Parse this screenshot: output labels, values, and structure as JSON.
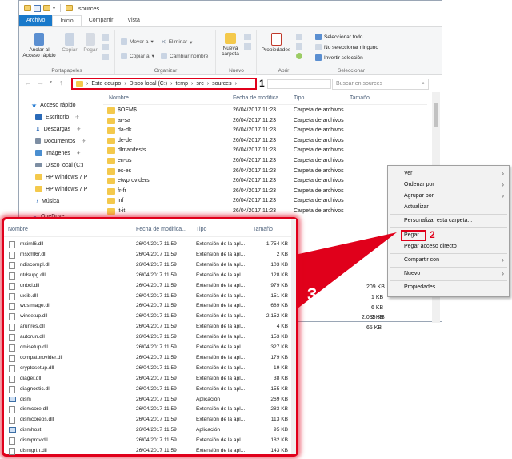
{
  "window": {
    "title": "sources"
  },
  "ribbon_tabs": [
    "Archivo",
    "Inicio",
    "Compartir",
    "Vista"
  ],
  "ribbon": {
    "portapapeles": {
      "label": "Portapapeles",
      "anclar": "Anclar al",
      "anclar2": "Acceso rápido",
      "copiar": "Copiar",
      "pegar": "Pegar"
    },
    "organizar": {
      "label": "Organizar",
      "mover": "Mover a",
      "copiar_a": "Copiar a",
      "eliminar": "Eliminar",
      "cambiar": "Cambiar nombre"
    },
    "nuevo": {
      "label": "Nuevo",
      "nueva": "Nueva",
      "carpeta": "carpeta"
    },
    "abrir": {
      "label": "Abrir",
      "propiedades": "Propiedades"
    },
    "seleccionar": {
      "label": "Seleccionar",
      "todo": "Seleccionar todo",
      "ninguno": "No seleccionar ninguno",
      "invertir": "Invertir selección"
    }
  },
  "address": {
    "path": [
      "Este equipo",
      "Disco local (C:)",
      "temp",
      "src",
      "sources"
    ],
    "marker": "1"
  },
  "search": {
    "placeholder": "Buscar en sources"
  },
  "nav_pane": [
    {
      "label": "Acceso rápido",
      "icon": "star-icon",
      "color": "#1f77d0"
    },
    {
      "label": "Escritorio",
      "icon": "desktop-icon",
      "color": "#2a6ab8"
    },
    {
      "label": "Descargas",
      "icon": "download-icon",
      "color": "#2a6ab8"
    },
    {
      "label": "Documentos",
      "icon": "document-icon",
      "color": "#7d8ea3"
    },
    {
      "label": "Imágenes",
      "icon": "pictures-icon",
      "color": "#4a8ed0"
    },
    {
      "label": "Disco local (C:)",
      "icon": "drive-icon",
      "color": "#7d8ea3"
    },
    {
      "label": "HP Windows 7 P",
      "icon": "folder-icon",
      "color": "#f4c94c"
    },
    {
      "label": "HP Windows 7 P",
      "icon": "folder-icon",
      "color": "#f4c94c"
    },
    {
      "label": "Música",
      "icon": "music-icon",
      "color": "#2a6ab8"
    },
    {
      "label": "OneDrive",
      "icon": "cloud-icon",
      "color": "#1f77d0"
    }
  ],
  "list_header": {
    "nombre": "Nombre",
    "fecha": "Fecha de modifica...",
    "tipo": "Tipo",
    "tamano": "Tamaño"
  },
  "folders": [
    {
      "name": "$OEM$",
      "date": "26/04/2017 11:23",
      "type": "Carpeta de archivos"
    },
    {
      "name": "ar-sa",
      "date": "26/04/2017 11:23",
      "type": "Carpeta de archivos"
    },
    {
      "name": "da-dk",
      "date": "26/04/2017 11:23",
      "type": "Carpeta de archivos"
    },
    {
      "name": "de-de",
      "date": "26/04/2017 11:23",
      "type": "Carpeta de archivos"
    },
    {
      "name": "dlmanifests",
      "date": "26/04/2017 11:23",
      "type": "Carpeta de archivos"
    },
    {
      "name": "en-us",
      "date": "26/04/2017 11:23",
      "type": "Carpeta de archivos"
    },
    {
      "name": "es-es",
      "date": "26/04/2017 11:23",
      "type": "Carpeta de archivos"
    },
    {
      "name": "etwproviders",
      "date": "26/04/2017 11:23",
      "type": "Carpeta de archivos"
    },
    {
      "name": "fr-fr",
      "date": "26/04/2017 11:23",
      "type": "Carpeta de archivos"
    },
    {
      "name": "inf",
      "date": "26/04/2017 11:23",
      "type": "Carpeta de archivos"
    },
    {
      "name": "it-it",
      "date": "26/04/2017 11:23",
      "type": "Carpeta de archivos"
    }
  ],
  "partial_sizes": [
    "209 KB",
    "1 KB",
    "6 KB",
    "2 KB",
    "2.085 KB",
    "65 KB"
  ],
  "context_menu": {
    "ver": "Ver",
    "ordenar": "Ordenar por",
    "agrupar": "Agrupar por",
    "actualizar": "Actualizar",
    "personalizar": "Personalizar esta carpeta...",
    "pegar": "Pegar",
    "pegar_acceso": "Pegar acceso directo",
    "compartir": "Compartir con",
    "nuevo": "Nuevo",
    "propiedades": "Propiedades",
    "marker": "2"
  },
  "panel": {
    "marker": "3",
    "header": {
      "nombre": "Nombre",
      "fecha": "Fecha de modifica...",
      "tipo": "Tipo",
      "tamano": "Tamaño"
    },
    "files": [
      {
        "name": "mximl6.dll",
        "date": "26/04/2017 11:59",
        "type": "Extensión de la apl...",
        "size": "1.754 KB",
        "kind": "dll"
      },
      {
        "name": "msxml6r.dll",
        "date": "26/04/2017 11:59",
        "type": "Extensión de la apl...",
        "size": "2 KB",
        "kind": "dll"
      },
      {
        "name": "ndiscompl.dll",
        "date": "26/04/2017 11:59",
        "type": "Extensión de la apl...",
        "size": "103 KB",
        "kind": "dll"
      },
      {
        "name": "ntdsupg.dll",
        "date": "26/04/2017 11:59",
        "type": "Extensión de la apl...",
        "size": "128 KB",
        "kind": "dll"
      },
      {
        "name": "unbcl.dll",
        "date": "26/04/2017 11:59",
        "type": "Extensión de la apl...",
        "size": "979 KB",
        "kind": "dll"
      },
      {
        "name": "uxlib.dll",
        "date": "26/04/2017 11:59",
        "type": "Extensión de la apl...",
        "size": "151 KB",
        "kind": "dll"
      },
      {
        "name": "wdsimage.dll",
        "date": "26/04/2017 11:59",
        "type": "Extensión de la apl...",
        "size": "689 KB",
        "kind": "dll"
      },
      {
        "name": "winsetup.dll",
        "date": "26/04/2017 11:59",
        "type": "Extensión de la apl...",
        "size": "2.152 KB",
        "kind": "dll"
      },
      {
        "name": "arunres.dll",
        "date": "26/04/2017 11:59",
        "type": "Extensión de la apl...",
        "size": "4 KB",
        "kind": "dll"
      },
      {
        "name": "autorun.dll",
        "date": "26/04/2017 11:59",
        "type": "Extensión de la apl...",
        "size": "153 KB",
        "kind": "dll"
      },
      {
        "name": "cmisetup.dll",
        "date": "26/04/2017 11:59",
        "type": "Extensión de la apl...",
        "size": "327 KB",
        "kind": "dll"
      },
      {
        "name": "compatprovider.dll",
        "date": "26/04/2017 11:59",
        "type": "Extensión de la apl...",
        "size": "179 KB",
        "kind": "dll"
      },
      {
        "name": "cryptosetup.dll",
        "date": "26/04/2017 11:59",
        "type": "Extensión de la apl...",
        "size": "19 KB",
        "kind": "dll"
      },
      {
        "name": "diager.dll",
        "date": "26/04/2017 11:59",
        "type": "Extensión de la apl...",
        "size": "38 KB",
        "kind": "dll"
      },
      {
        "name": "diagnostic.dll",
        "date": "26/04/2017 11:59",
        "type": "Extensión de la apl...",
        "size": "155 KB",
        "kind": "dll"
      },
      {
        "name": "dism",
        "date": "26/04/2017 11:59",
        "type": "Aplicación",
        "size": "269 KB",
        "kind": "app"
      },
      {
        "name": "dismcore.dll",
        "date": "26/04/2017 11:59",
        "type": "Extensión de la apl...",
        "size": "283 KB",
        "kind": "dll"
      },
      {
        "name": "dismcoreps.dll",
        "date": "26/04/2017 11:59",
        "type": "Extensión de la apl...",
        "size": "113 KB",
        "kind": "dll"
      },
      {
        "name": "dismhost",
        "date": "26/04/2017 11:59",
        "type": "Aplicación",
        "size": "95 KB",
        "kind": "app"
      },
      {
        "name": "dismprov.dll",
        "date": "26/04/2017 11:59",
        "type": "Extensión de la apl...",
        "size": "182 KB",
        "kind": "dll"
      },
      {
        "name": "dismgrtn.dll",
        "date": "26/04/2017 11:59",
        "type": "Extensión de la apl...",
        "size": "143 KB",
        "kind": "dll"
      }
    ]
  },
  "colors": {
    "accent": "#1979ca",
    "highlight": "#e0001b",
    "folder": "#f4c94c"
  }
}
